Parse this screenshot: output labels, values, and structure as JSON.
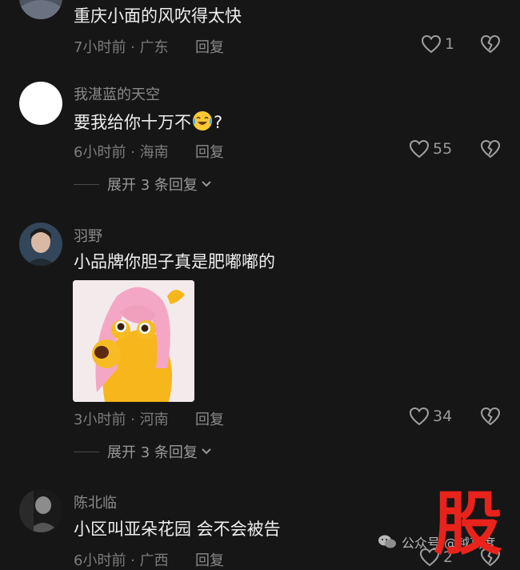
{
  "comments": [
    {
      "content": "重庆小面的风吹得太快",
      "time_location": "7小时前 · 广东",
      "reply_label": "回复",
      "likes": "1"
    },
    {
      "username": "我湛蓝的天空",
      "content_prefix": "要我给你十万不",
      "content_suffix": "?",
      "time_location": "6小时前 · 海南",
      "reply_label": "回复",
      "likes": "55",
      "expand_label": "展开 3 条回复"
    },
    {
      "username": "羽野",
      "content": "小品牌你胆子真是肥嘟嘟的",
      "time_location": "3小时前 · 河南",
      "reply_label": "回复",
      "likes": "34",
      "expand_label": "展开 3 条回复"
    },
    {
      "username": "陈北临",
      "content": "小区叫亚朵花园 会不会被告",
      "time_location": "6小时前 · 广西",
      "reply_label": "回复",
      "likes": "2"
    }
  ],
  "watermark": {
    "text": "公众号 @越高度"
  },
  "stamp": {
    "text": "股"
  },
  "icons": {
    "like": "heart-icon",
    "dislike": "broken-heart-icon",
    "expand": "chevron-down-icon",
    "emoji": "laughing-crying-emoji-icon",
    "wechat": "wechat-icon"
  },
  "colors": {
    "background": "#161616",
    "stamp_red": "#e8231c"
  }
}
